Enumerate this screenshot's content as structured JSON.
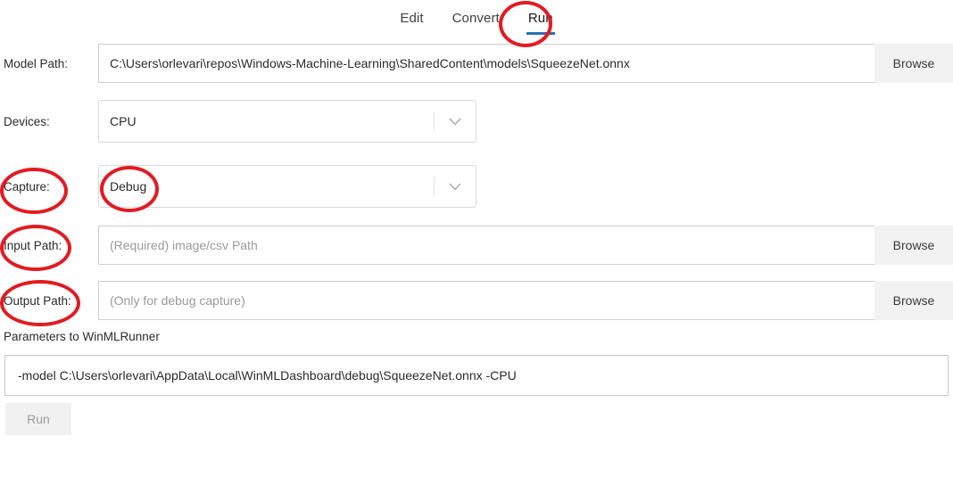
{
  "tabs": [
    {
      "label": "Edit",
      "active": false
    },
    {
      "label": "Convert",
      "active": false
    },
    {
      "label": "Run",
      "active": true
    }
  ],
  "form": {
    "model_path": {
      "label": "Model Path:",
      "value": "C:\\Users\\orlevari\\repos\\Windows-Machine-Learning\\SharedContent\\models\\SqueezeNet.onnx",
      "browse_label": "Browse"
    },
    "devices": {
      "label": "Devices:",
      "value": "CPU"
    },
    "capture": {
      "label": "Capture:",
      "value": "Debug"
    },
    "input_path": {
      "label": "Input Path:",
      "placeholder": "(Required) image/csv Path",
      "browse_label": "Browse"
    },
    "output_path": {
      "label": "Output Path:",
      "placeholder": "(Only for debug capture)",
      "browse_label": "Browse"
    },
    "parameters": {
      "label": "Parameters to WinMLRunner",
      "value": "-model C:\\Users\\orlevari\\AppData\\Local\\WinMLDashboard\\debug\\SqueezeNet.onnx -CPU"
    },
    "run_button": {
      "label": "Run"
    }
  },
  "annotations": {
    "color": "#e21b22",
    "targets": [
      "Run tab",
      "Capture:",
      "Debug",
      "Input Path:",
      "Output Path:"
    ]
  },
  "theme": {
    "accent": "#2a6fb8",
    "field_border": "#cfcfcf",
    "button_bg": "#f2f2f2"
  }
}
